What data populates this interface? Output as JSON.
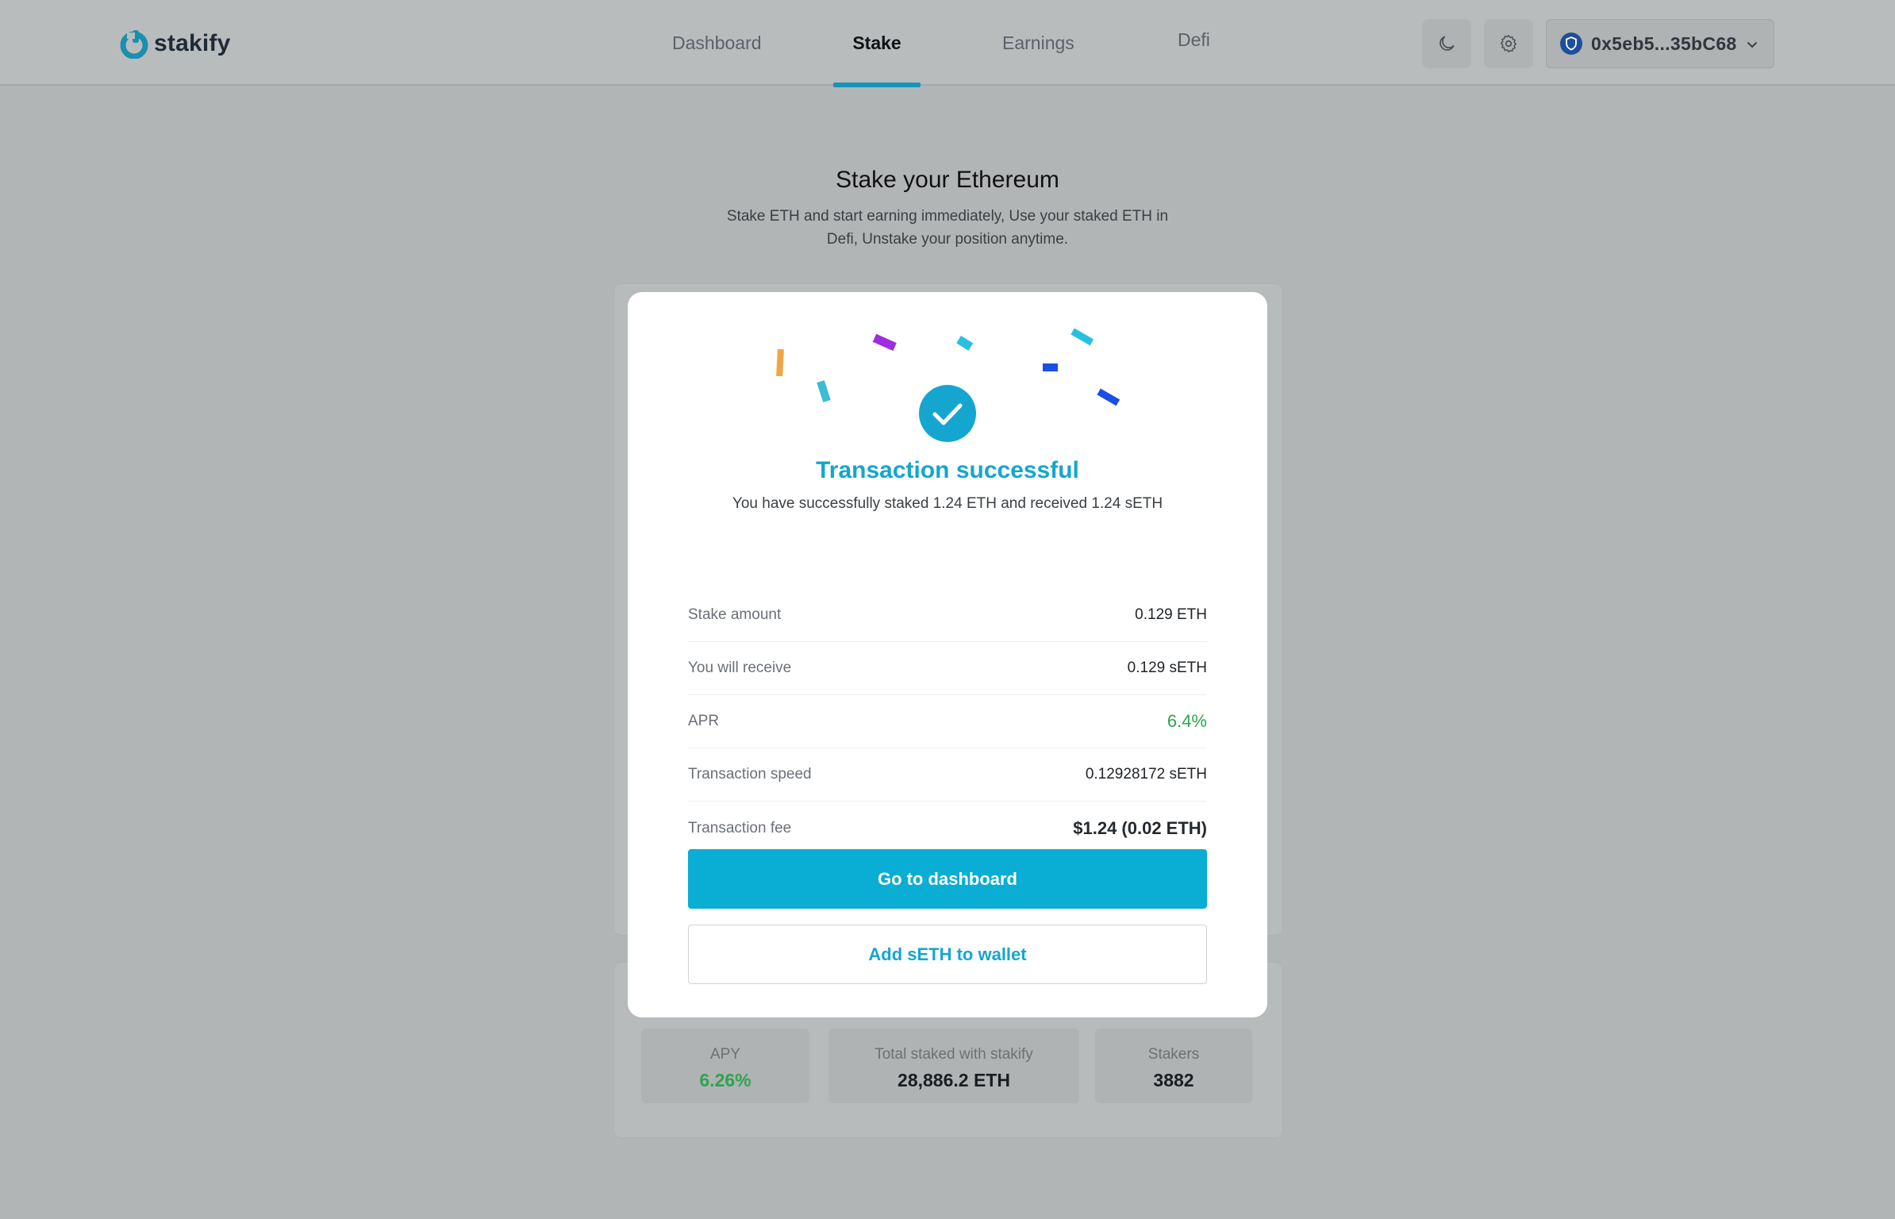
{
  "brand": {
    "name": "stakify",
    "accent": "#14a6cf"
  },
  "nav": {
    "items": [
      {
        "label": "Dashboard",
        "active": false
      },
      {
        "label": "Stake",
        "active": true
      },
      {
        "label": "Earnings",
        "active": false
      },
      {
        "label": "Defi",
        "active": false
      }
    ]
  },
  "header": {
    "theme_icon": "moon-icon",
    "settings_icon": "gear-icon",
    "wallet": {
      "address": "0x5eb5...35bC68",
      "icon": "shield-icon"
    }
  },
  "page": {
    "title": "Stake your Ethereum",
    "subtitle": "Stake ETH and start earning immediately, Use your staked ETH in Defi, Unstake your position anytime."
  },
  "modal": {
    "title": "Transaction successful",
    "message": "You have successfully staked 1.24 ETH and received 1.24 sETH",
    "rows": [
      {
        "label": "Stake amount",
        "value": "0.129 ETH"
      },
      {
        "label": "You will receive",
        "value": "0.129 sETH"
      },
      {
        "label": "APR",
        "value": "6.4%"
      },
      {
        "label": "Transaction speed",
        "value": "0.12928172 sETH"
      },
      {
        "label": "Transaction fee",
        "value": "$1.24 (0.02 ETH)"
      }
    ],
    "primary_button": "Go to dashboard",
    "secondary_button": "Add sETH to wallet"
  },
  "stats": [
    {
      "label": "APY",
      "value": "6.26%"
    },
    {
      "label": "Total staked with stakify",
      "value": "28,886.2 ETH"
    },
    {
      "label": "Stakers",
      "value": "3882"
    }
  ],
  "colors": {
    "success": "#2ea44f",
    "primary": "#0aadd4"
  }
}
